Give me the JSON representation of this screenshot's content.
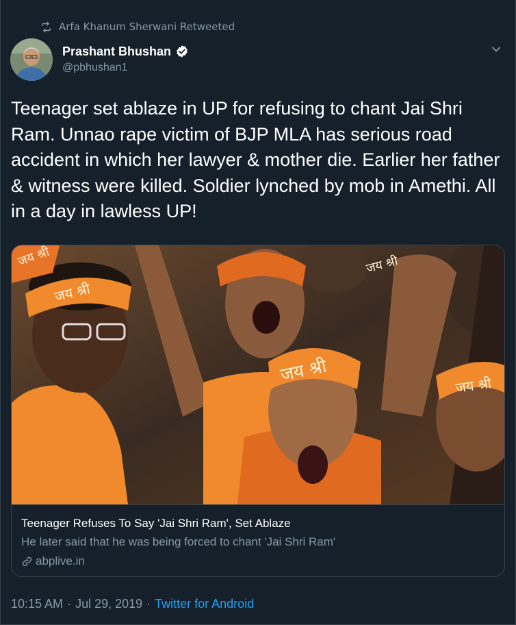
{
  "retweet": {
    "text": "Arfa Khanum Sherwani Retweeted",
    "icon": "retweet-icon"
  },
  "author": {
    "name": "Prashant Bhushan",
    "handle": "@pbhushan1",
    "verified": true
  },
  "tweet": {
    "text": "Teenager set ablaze in UP for refusing to chant Jai Shri Ram. Unnao rape victim of BJP MLA has serious road accident in which her lawyer & mother die. Earlier her father & witness were killed. Soldier lynched by mob in Amethi. All in a day in lawless UP!"
  },
  "card": {
    "image_headbands": [
      "जय श्री",
      "जय श्री",
      "जय श्री",
      "जय श्री",
      "जय श्री"
    ],
    "title": "Teenager Refuses To Say 'Jai Shri Ram', Set Ablaze",
    "description": "He later said that he was being forced to chant 'Jai Shri Ram'",
    "domain": "abplive.in"
  },
  "meta": {
    "time": "10:15 AM",
    "separator": "·",
    "date": "Jul 29, 2019",
    "separator2": "·",
    "source": "Twitter for Android"
  },
  "colors": {
    "background": "#15202b",
    "border": "#38444d",
    "secondary_text": "#8899a6",
    "link": "#1da1f2",
    "saffron": "#f08a2c"
  }
}
